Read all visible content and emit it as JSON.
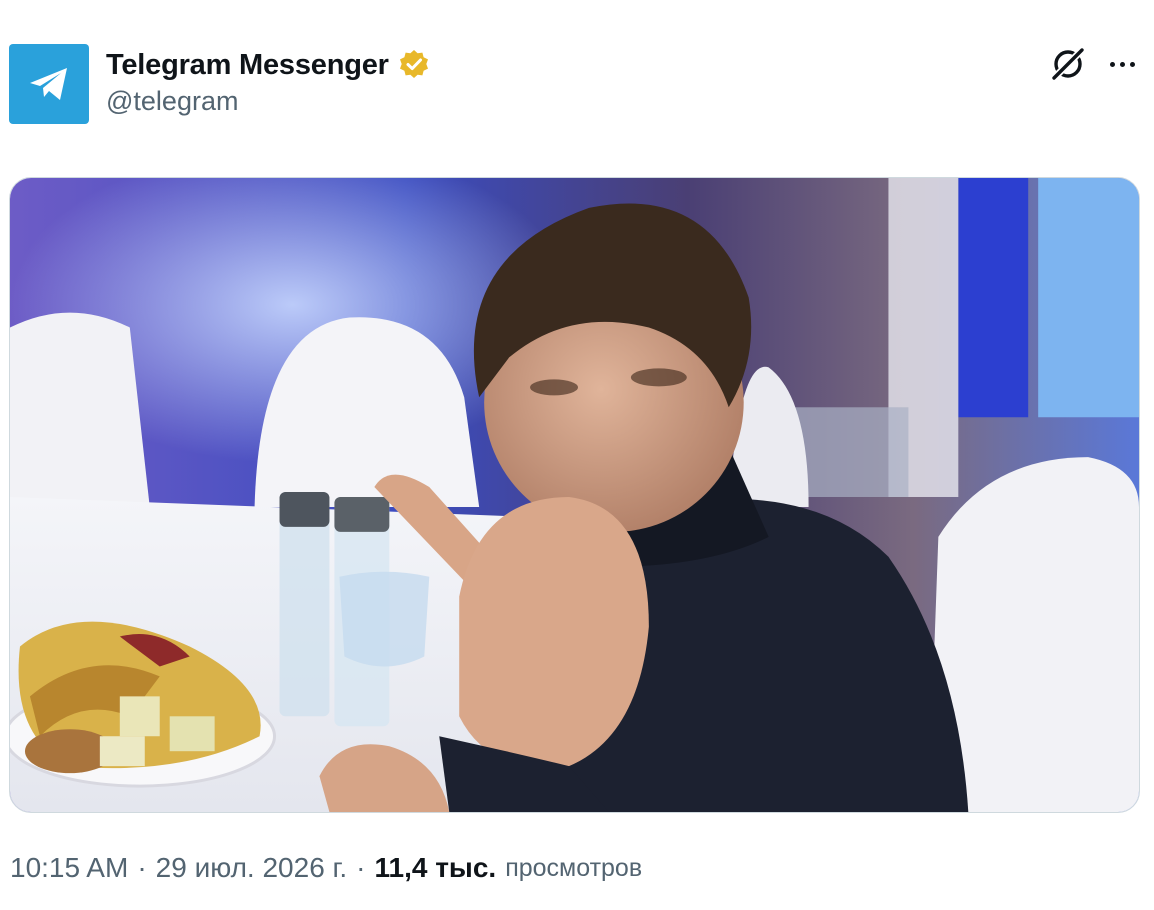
{
  "author": {
    "display_name": "Telegram Messenger",
    "handle": "@telegram",
    "verified": true,
    "avatar_icon": "paper-plane-icon",
    "avatar_color": "#2aa1db",
    "verified_color": "#e8b82a"
  },
  "actions": {
    "grok_icon": "grok-icon",
    "more_icon": "more-horizontal-icon"
  },
  "meta": {
    "time": "10:15 AM",
    "separator": "·",
    "date": "29 июл. 2026 г.",
    "views_count": "11,4 тыс.",
    "views_label": "просмотров"
  },
  "colors": {
    "text_primary": "#0f1419",
    "text_secondary": "#536471",
    "border": "#cfd9de"
  }
}
